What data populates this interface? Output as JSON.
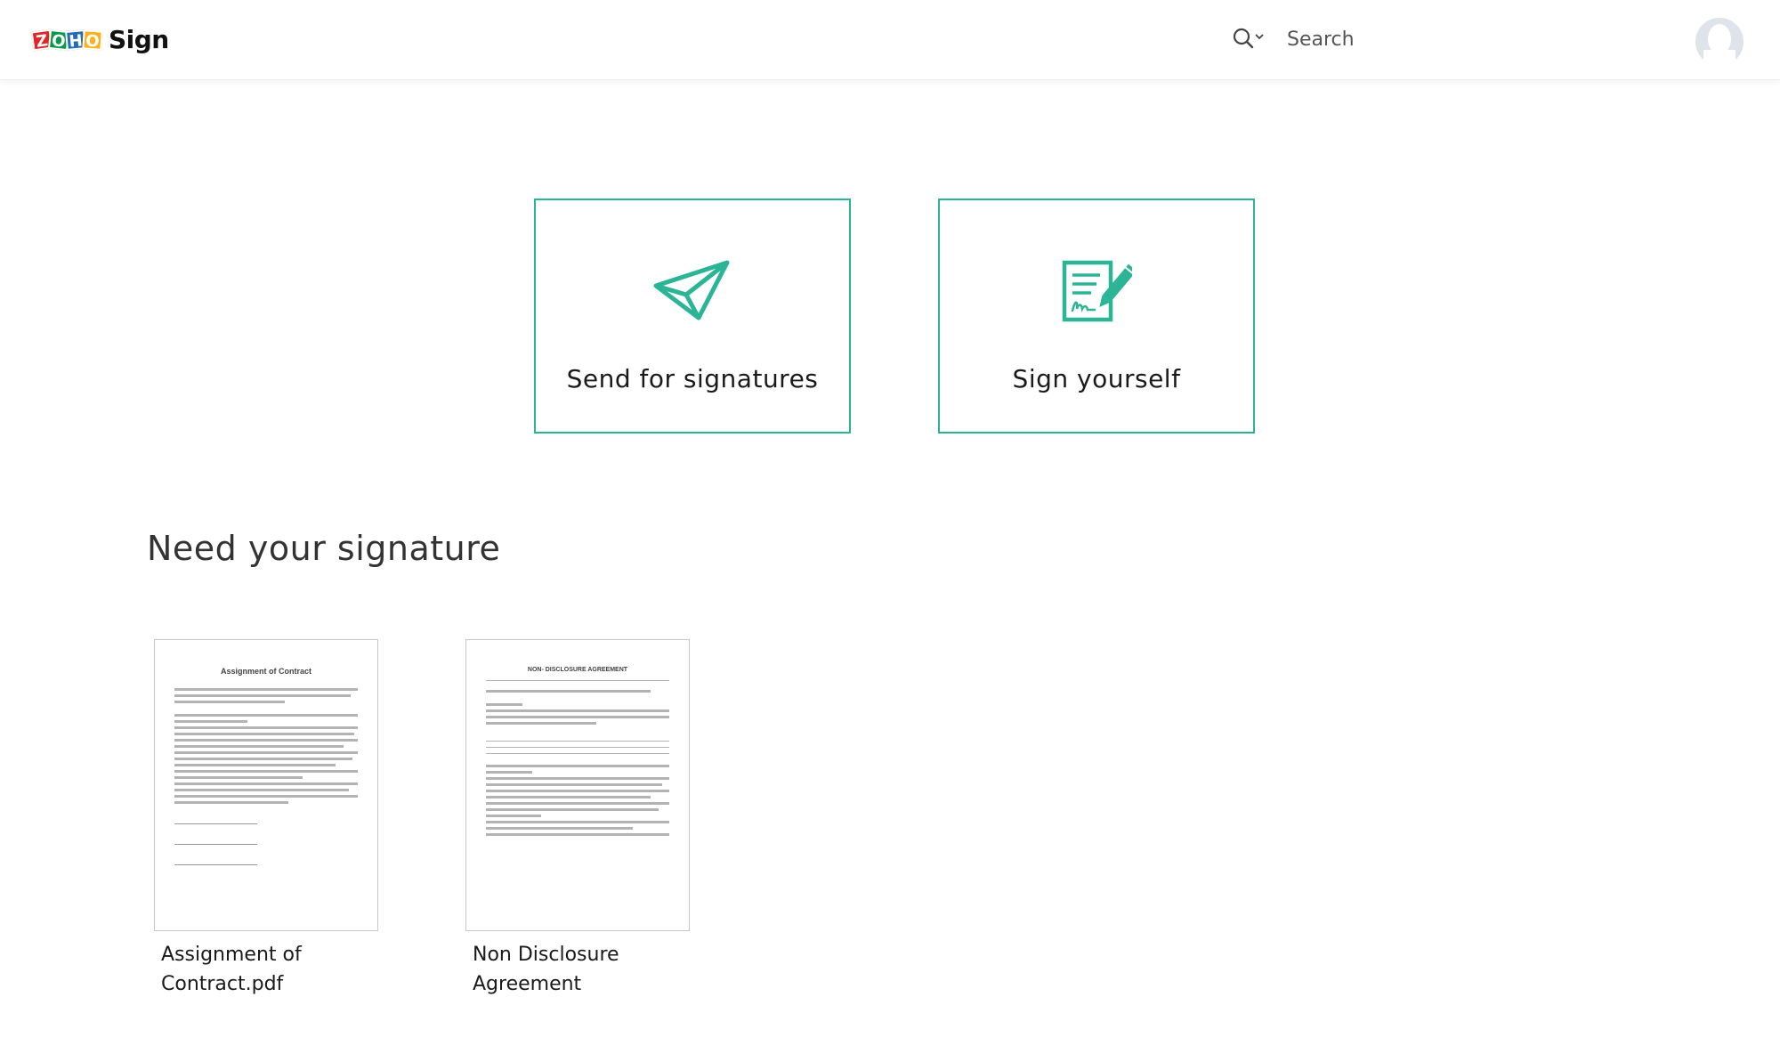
{
  "app": {
    "brand_letters": [
      "Z",
      "O",
      "H",
      "O"
    ],
    "product_name": "Sign"
  },
  "header": {
    "search_placeholder": "Search"
  },
  "actions": [
    {
      "label": "Send for signatures",
      "icon": "paper-plane-icon"
    },
    {
      "label": "Sign yourself",
      "icon": "sign-document-icon"
    }
  ],
  "section": {
    "title": "Need your signature"
  },
  "documents": [
    {
      "name_line1": "Assignment of",
      "name_line2": "Contract.pdf",
      "thumb_title": "Assignment of Contract"
    },
    {
      "name_line1": "Non Disclosure",
      "name_line2": "Agreement",
      "thumb_title": "NON- DISCLOSURE AGREEMENT"
    }
  ],
  "colors": {
    "accent": "#2bb596",
    "zoho_red": "#e42527",
    "zoho_green": "#089949",
    "zoho_blue": "#226db4",
    "zoho_yellow": "#f9b21d"
  }
}
